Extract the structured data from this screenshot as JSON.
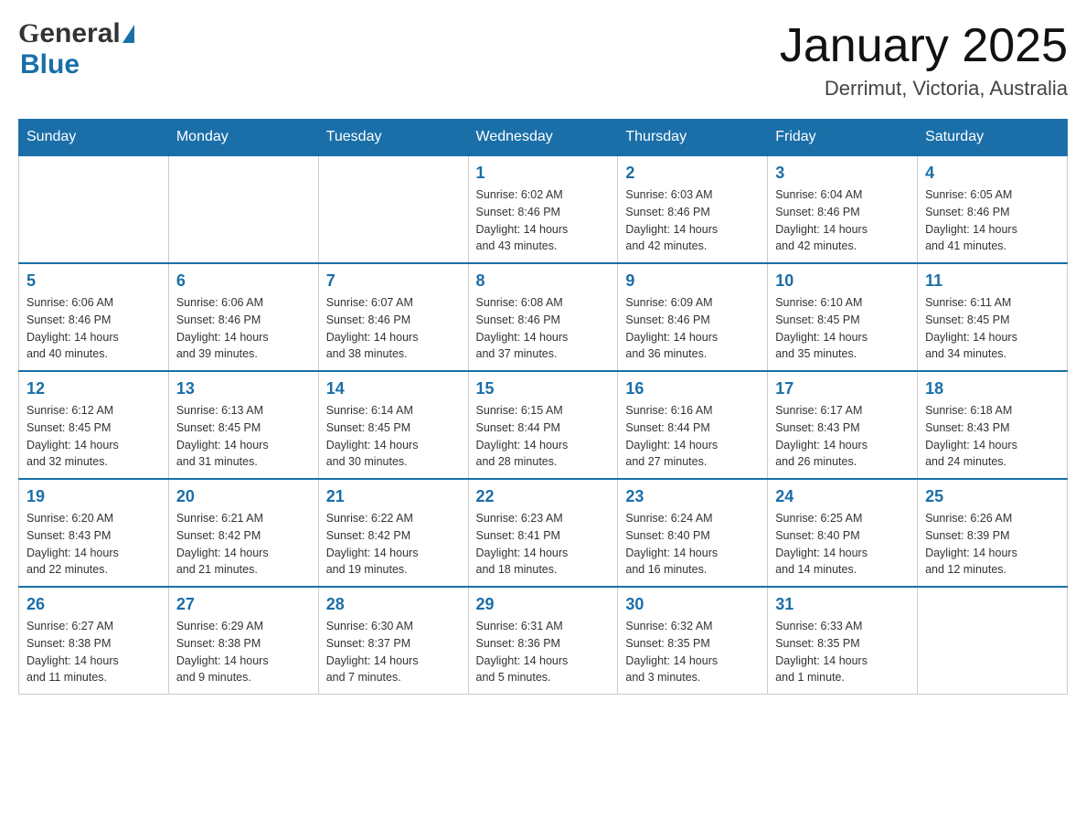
{
  "header": {
    "logo_general": "General",
    "logo_blue": "Blue",
    "month_title": "January 2025",
    "location": "Derrimut, Victoria, Australia"
  },
  "calendar": {
    "days_of_week": [
      "Sunday",
      "Monday",
      "Tuesday",
      "Wednesday",
      "Thursday",
      "Friday",
      "Saturday"
    ],
    "weeks": [
      [
        {
          "day": "",
          "info": ""
        },
        {
          "day": "",
          "info": ""
        },
        {
          "day": "",
          "info": ""
        },
        {
          "day": "1",
          "info": "Sunrise: 6:02 AM\nSunset: 8:46 PM\nDaylight: 14 hours\nand 43 minutes."
        },
        {
          "day": "2",
          "info": "Sunrise: 6:03 AM\nSunset: 8:46 PM\nDaylight: 14 hours\nand 42 minutes."
        },
        {
          "day": "3",
          "info": "Sunrise: 6:04 AM\nSunset: 8:46 PM\nDaylight: 14 hours\nand 42 minutes."
        },
        {
          "day": "4",
          "info": "Sunrise: 6:05 AM\nSunset: 8:46 PM\nDaylight: 14 hours\nand 41 minutes."
        }
      ],
      [
        {
          "day": "5",
          "info": "Sunrise: 6:06 AM\nSunset: 8:46 PM\nDaylight: 14 hours\nand 40 minutes."
        },
        {
          "day": "6",
          "info": "Sunrise: 6:06 AM\nSunset: 8:46 PM\nDaylight: 14 hours\nand 39 minutes."
        },
        {
          "day": "7",
          "info": "Sunrise: 6:07 AM\nSunset: 8:46 PM\nDaylight: 14 hours\nand 38 minutes."
        },
        {
          "day": "8",
          "info": "Sunrise: 6:08 AM\nSunset: 8:46 PM\nDaylight: 14 hours\nand 37 minutes."
        },
        {
          "day": "9",
          "info": "Sunrise: 6:09 AM\nSunset: 8:46 PM\nDaylight: 14 hours\nand 36 minutes."
        },
        {
          "day": "10",
          "info": "Sunrise: 6:10 AM\nSunset: 8:45 PM\nDaylight: 14 hours\nand 35 minutes."
        },
        {
          "day": "11",
          "info": "Sunrise: 6:11 AM\nSunset: 8:45 PM\nDaylight: 14 hours\nand 34 minutes."
        }
      ],
      [
        {
          "day": "12",
          "info": "Sunrise: 6:12 AM\nSunset: 8:45 PM\nDaylight: 14 hours\nand 32 minutes."
        },
        {
          "day": "13",
          "info": "Sunrise: 6:13 AM\nSunset: 8:45 PM\nDaylight: 14 hours\nand 31 minutes."
        },
        {
          "day": "14",
          "info": "Sunrise: 6:14 AM\nSunset: 8:45 PM\nDaylight: 14 hours\nand 30 minutes."
        },
        {
          "day": "15",
          "info": "Sunrise: 6:15 AM\nSunset: 8:44 PM\nDaylight: 14 hours\nand 28 minutes."
        },
        {
          "day": "16",
          "info": "Sunrise: 6:16 AM\nSunset: 8:44 PM\nDaylight: 14 hours\nand 27 minutes."
        },
        {
          "day": "17",
          "info": "Sunrise: 6:17 AM\nSunset: 8:43 PM\nDaylight: 14 hours\nand 26 minutes."
        },
        {
          "day": "18",
          "info": "Sunrise: 6:18 AM\nSunset: 8:43 PM\nDaylight: 14 hours\nand 24 minutes."
        }
      ],
      [
        {
          "day": "19",
          "info": "Sunrise: 6:20 AM\nSunset: 8:43 PM\nDaylight: 14 hours\nand 22 minutes."
        },
        {
          "day": "20",
          "info": "Sunrise: 6:21 AM\nSunset: 8:42 PM\nDaylight: 14 hours\nand 21 minutes."
        },
        {
          "day": "21",
          "info": "Sunrise: 6:22 AM\nSunset: 8:42 PM\nDaylight: 14 hours\nand 19 minutes."
        },
        {
          "day": "22",
          "info": "Sunrise: 6:23 AM\nSunset: 8:41 PM\nDaylight: 14 hours\nand 18 minutes."
        },
        {
          "day": "23",
          "info": "Sunrise: 6:24 AM\nSunset: 8:40 PM\nDaylight: 14 hours\nand 16 minutes."
        },
        {
          "day": "24",
          "info": "Sunrise: 6:25 AM\nSunset: 8:40 PM\nDaylight: 14 hours\nand 14 minutes."
        },
        {
          "day": "25",
          "info": "Sunrise: 6:26 AM\nSunset: 8:39 PM\nDaylight: 14 hours\nand 12 minutes."
        }
      ],
      [
        {
          "day": "26",
          "info": "Sunrise: 6:27 AM\nSunset: 8:38 PM\nDaylight: 14 hours\nand 11 minutes."
        },
        {
          "day": "27",
          "info": "Sunrise: 6:29 AM\nSunset: 8:38 PM\nDaylight: 14 hours\nand 9 minutes."
        },
        {
          "day": "28",
          "info": "Sunrise: 6:30 AM\nSunset: 8:37 PM\nDaylight: 14 hours\nand 7 minutes."
        },
        {
          "day": "29",
          "info": "Sunrise: 6:31 AM\nSunset: 8:36 PM\nDaylight: 14 hours\nand 5 minutes."
        },
        {
          "day": "30",
          "info": "Sunrise: 6:32 AM\nSunset: 8:35 PM\nDaylight: 14 hours\nand 3 minutes."
        },
        {
          "day": "31",
          "info": "Sunrise: 6:33 AM\nSunset: 8:35 PM\nDaylight: 14 hours\nand 1 minute."
        },
        {
          "day": "",
          "info": ""
        }
      ]
    ]
  }
}
